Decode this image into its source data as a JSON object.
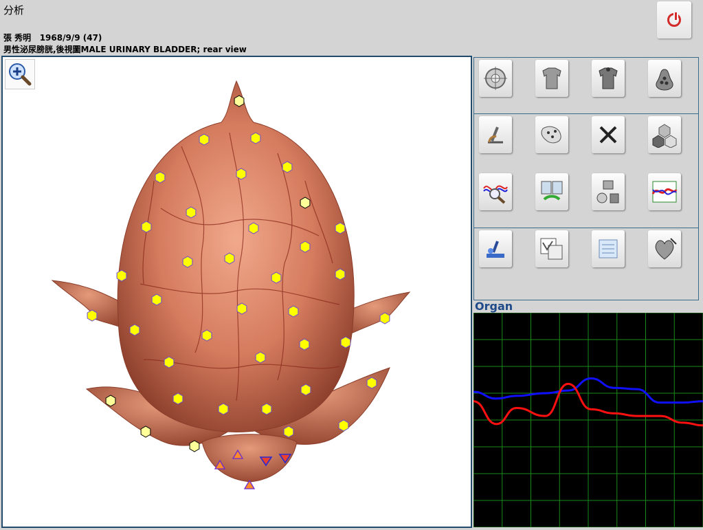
{
  "header": {
    "title": "分析",
    "patient": "張 秀明   1968/9/9 (47)",
    "view": "男性泌尿膀胱,後視圖MALE URINARY BLADDER; rear view"
  },
  "toolbar": {
    "power_icon": "power-icon",
    "zoom_icon": "zoom-in-icon",
    "tools": [
      "target-icon",
      "shirt-icon",
      "shirt-dark-icon",
      "pear-icon",
      "microscope-icon",
      "tissue-icon",
      "close-icon",
      "cells-icon",
      "wave-search-icon",
      "compare-icon",
      "organs-icon",
      "wave-chart-icon",
      "lab-icon",
      "picture-icon",
      "notes-icon",
      "heart-icon"
    ]
  },
  "chart_label": "Organ",
  "colors": {
    "accent": "#1f4a6b",
    "series_blue": "#1010ff",
    "series_red": "#ff1010",
    "grid": "#1a8c1a",
    "marker_fill": "#ffff00",
    "marker_light": "#ffff99"
  },
  "chart_data": {
    "type": "line",
    "title": "",
    "xlim": [
      0,
      8
    ],
    "ylim": [
      0,
      8
    ],
    "grid": true,
    "series": [
      {
        "values": [
          [
            0,
            5.05
          ],
          [
            0.8,
            4.8
          ],
          [
            1.5,
            4.9
          ],
          [
            2.5,
            5.0
          ],
          [
            3.3,
            5.1
          ],
          [
            4.1,
            5.55
          ],
          [
            4.9,
            5.2
          ],
          [
            5.7,
            5.15
          ],
          [
            6.5,
            4.65
          ],
          [
            7.3,
            4.65
          ],
          [
            8,
            4.7
          ]
        ]
      },
      {
        "values": [
          [
            0,
            4.7
          ],
          [
            0.8,
            3.85
          ],
          [
            1.5,
            4.45
          ],
          [
            2.5,
            4.15
          ],
          [
            3.3,
            5.35
          ],
          [
            4.1,
            4.4
          ],
          [
            4.9,
            4.25
          ],
          [
            5.7,
            4.15
          ],
          [
            6.5,
            4.15
          ],
          [
            7.3,
            3.9
          ],
          [
            8,
            3.8
          ]
        ]
      }
    ]
  }
}
